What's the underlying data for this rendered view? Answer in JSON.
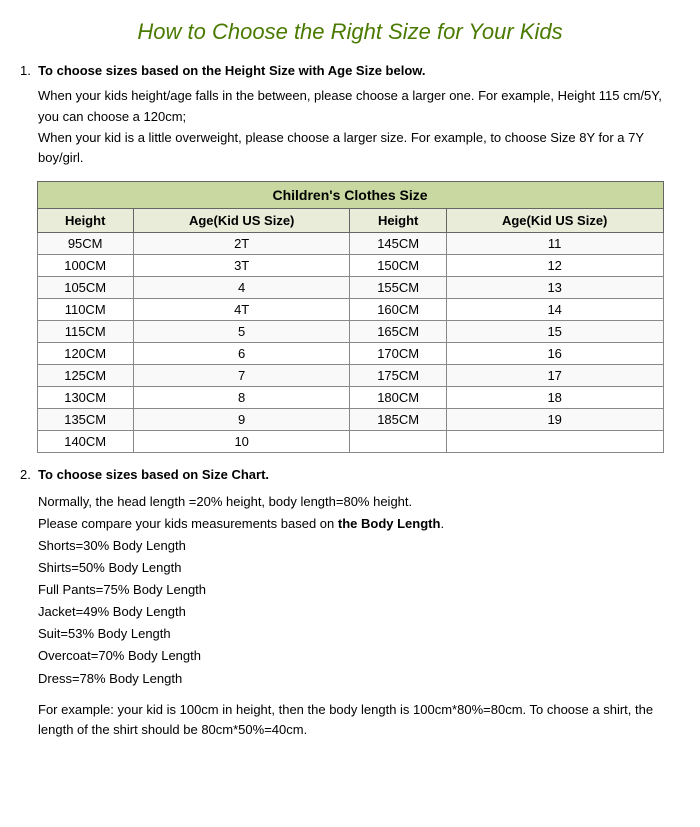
{
  "title": "How to Choose the Right Size for Your Kids",
  "section1": {
    "heading": "To choose sizes based on the Height Size with Age Size below.",
    "body1": "When your kids height/age falls in the between, please choose a larger one. For example, Height 115 cm/5Y, you can choose a 120cm;",
    "body2": "When your kid is a little overweight, please choose a larger size. For example, to choose Size 8Y for a 7Y boy/girl."
  },
  "table": {
    "title": "Children's Clothes Size",
    "col_headers": [
      "Height",
      "Age(Kid US Size)",
      "Height",
      "Age(Kid US Size)"
    ],
    "rows": [
      [
        "95CM",
        "2T",
        "145CM",
        "11"
      ],
      [
        "100CM",
        "3T",
        "150CM",
        "12"
      ],
      [
        "105CM",
        "4",
        "155CM",
        "13"
      ],
      [
        "110CM",
        "4T",
        "160CM",
        "14"
      ],
      [
        "115CM",
        "5",
        "165CM",
        "15"
      ],
      [
        "120CM",
        "6",
        "170CM",
        "16"
      ],
      [
        "125CM",
        "7",
        "175CM",
        "17"
      ],
      [
        "130CM",
        "8",
        "180CM",
        "18"
      ],
      [
        "135CM",
        "9",
        "185CM",
        "19"
      ],
      [
        "140CM",
        "10",
        "",
        ""
      ]
    ]
  },
  "section2": {
    "heading": "To choose sizes based on Size Chart.",
    "line1": "Normally, the head length =20% height, body length=80% height.",
    "line2_prefix": "Please compare your kids measurements based on ",
    "line2_bold": "the Body Length",
    "line2_suffix": ".",
    "items": [
      "Shorts=30% Body Length",
      "Shirts=50% Body Length",
      "Full Pants=75% Body Length",
      "Jacket=49% Body Length",
      "Suit=53% Body Length",
      "Overcoat=70% Body Length",
      "Dress=78% Body Length"
    ],
    "example": "For example: your kid is 100cm in height, then the body length is 100cm*80%=80cm. To choose a shirt, the length of the shirt should be 80cm*50%=40cm."
  }
}
